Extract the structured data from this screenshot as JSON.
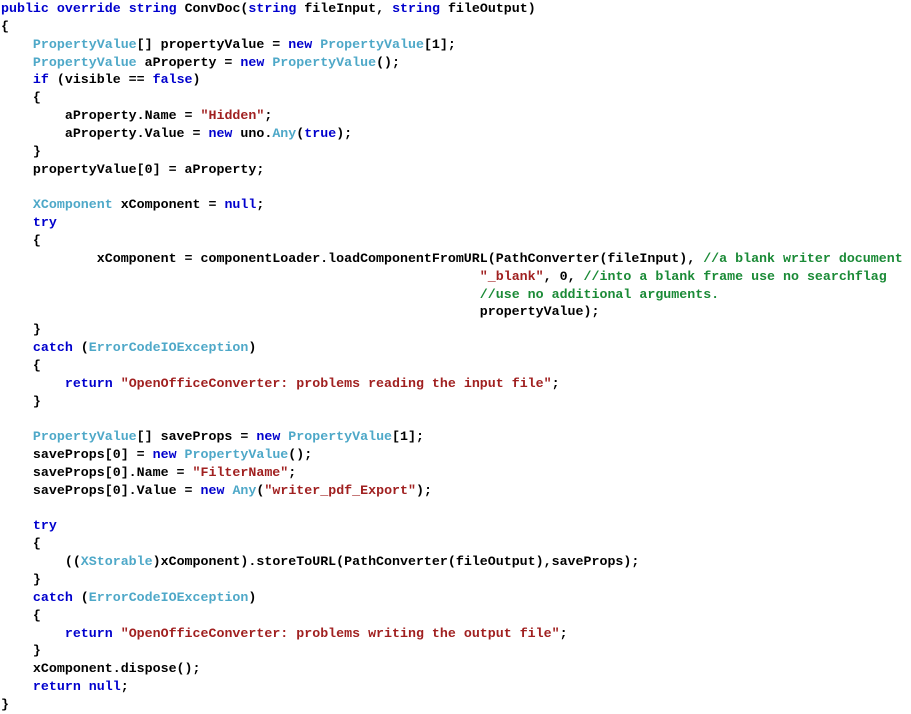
{
  "editor": {
    "language": "csharp",
    "background_color": "#ffffff",
    "font_size_px": 13.3,
    "line_height_px": 17.85,
    "colors": {
      "keyword": "#0000CD",
      "type": "#4EA8C8",
      "string": "#A02020",
      "comment": "#1A8A36",
      "plain": "#000000"
    }
  },
  "code": {
    "lines": [
      {
        "id": "line-1",
        "tokens": [
          {
            "t": "public",
            "c": "kw"
          },
          {
            "t": " ",
            "c": "pln"
          },
          {
            "t": "override",
            "c": "kw"
          },
          {
            "t": " ",
            "c": "pln"
          },
          {
            "t": "string",
            "c": "kw"
          },
          {
            "t": " ConvDoc(",
            "c": "pln"
          },
          {
            "t": "string",
            "c": "kw"
          },
          {
            "t": " fileInput, ",
            "c": "pln"
          },
          {
            "t": "string",
            "c": "kw"
          },
          {
            "t": " fileOutput)",
            "c": "pln"
          }
        ]
      },
      {
        "id": "line-2",
        "tokens": [
          {
            "t": "{",
            "c": "pln"
          }
        ]
      },
      {
        "id": "line-3",
        "tokens": [
          {
            "t": "    ",
            "c": "pln"
          },
          {
            "t": "PropertyValue",
            "c": "type"
          },
          {
            "t": "[] propertyValue = ",
            "c": "pln"
          },
          {
            "t": "new",
            "c": "kw"
          },
          {
            "t": " ",
            "c": "pln"
          },
          {
            "t": "PropertyValue",
            "c": "type"
          },
          {
            "t": "[1];",
            "c": "pln"
          }
        ]
      },
      {
        "id": "line-4",
        "tokens": [
          {
            "t": "    ",
            "c": "pln"
          },
          {
            "t": "PropertyValue",
            "c": "type"
          },
          {
            "t": " aProperty = ",
            "c": "pln"
          },
          {
            "t": "new",
            "c": "kw"
          },
          {
            "t": " ",
            "c": "pln"
          },
          {
            "t": "PropertyValue",
            "c": "type"
          },
          {
            "t": "();",
            "c": "pln"
          }
        ]
      },
      {
        "id": "line-5",
        "tokens": [
          {
            "t": "    ",
            "c": "pln"
          },
          {
            "t": "if",
            "c": "kw"
          },
          {
            "t": " (visible == ",
            "c": "pln"
          },
          {
            "t": "false",
            "c": "kw"
          },
          {
            "t": ")",
            "c": "pln"
          }
        ]
      },
      {
        "id": "line-6",
        "tokens": [
          {
            "t": "    {",
            "c": "pln"
          }
        ]
      },
      {
        "id": "line-7",
        "tokens": [
          {
            "t": "        aProperty.Name = ",
            "c": "pln"
          },
          {
            "t": "\"Hidden\"",
            "c": "str"
          },
          {
            "t": ";",
            "c": "pln"
          }
        ]
      },
      {
        "id": "line-8",
        "tokens": [
          {
            "t": "        aProperty.Value = ",
            "c": "pln"
          },
          {
            "t": "new",
            "c": "kw"
          },
          {
            "t": " uno.",
            "c": "pln"
          },
          {
            "t": "Any",
            "c": "type"
          },
          {
            "t": "(",
            "c": "pln"
          },
          {
            "t": "true",
            "c": "kw"
          },
          {
            "t": ");",
            "c": "pln"
          }
        ]
      },
      {
        "id": "line-9",
        "tokens": [
          {
            "t": "    }",
            "c": "pln"
          }
        ]
      },
      {
        "id": "line-10",
        "tokens": [
          {
            "t": "    propertyValue[0] = aProperty;",
            "c": "pln"
          }
        ]
      },
      {
        "id": "line-11",
        "tokens": [
          {
            "t": "",
            "c": "pln"
          }
        ]
      },
      {
        "id": "line-12",
        "tokens": [
          {
            "t": "    ",
            "c": "pln"
          },
          {
            "t": "XComponent",
            "c": "type"
          },
          {
            "t": " xComponent = ",
            "c": "pln"
          },
          {
            "t": "null",
            "c": "kw"
          },
          {
            "t": ";",
            "c": "pln"
          }
        ]
      },
      {
        "id": "line-13",
        "tokens": [
          {
            "t": "    ",
            "c": "pln"
          },
          {
            "t": "try",
            "c": "kw"
          }
        ]
      },
      {
        "id": "line-14",
        "tokens": [
          {
            "t": "    {",
            "c": "pln"
          }
        ]
      },
      {
        "id": "line-15",
        "tokens": [
          {
            "t": "            xComponent = componentLoader.loadComponentFromURL(PathConverter(fileInput), ",
            "c": "pln"
          },
          {
            "t": "//a blank writer document",
            "c": "com"
          }
        ]
      },
      {
        "id": "line-16",
        "tokens": [
          {
            "t": "                                                            ",
            "c": "pln"
          },
          {
            "t": "\"_blank\"",
            "c": "str"
          },
          {
            "t": ", 0, ",
            "c": "pln"
          },
          {
            "t": "//into a blank frame use no searchflag",
            "c": "com"
          }
        ]
      },
      {
        "id": "line-17",
        "tokens": [
          {
            "t": "                                                            ",
            "c": "pln"
          },
          {
            "t": "//use no additional arguments.",
            "c": "com"
          }
        ]
      },
      {
        "id": "line-18",
        "tokens": [
          {
            "t": "                                                            propertyValue);",
            "c": "pln"
          }
        ]
      },
      {
        "id": "line-19",
        "tokens": [
          {
            "t": "    }",
            "c": "pln"
          }
        ]
      },
      {
        "id": "line-20",
        "tokens": [
          {
            "t": "    ",
            "c": "pln"
          },
          {
            "t": "catch",
            "c": "kw"
          },
          {
            "t": " (",
            "c": "pln"
          },
          {
            "t": "ErrorCodeIOException",
            "c": "type"
          },
          {
            "t": ")",
            "c": "pln"
          }
        ]
      },
      {
        "id": "line-21",
        "tokens": [
          {
            "t": "    {",
            "c": "pln"
          }
        ]
      },
      {
        "id": "line-22",
        "tokens": [
          {
            "t": "        ",
            "c": "pln"
          },
          {
            "t": "return",
            "c": "kw"
          },
          {
            "t": " ",
            "c": "pln"
          },
          {
            "t": "\"OpenOfficeConverter: problems reading the input file\"",
            "c": "str"
          },
          {
            "t": ";",
            "c": "pln"
          }
        ]
      },
      {
        "id": "line-23",
        "tokens": [
          {
            "t": "    }",
            "c": "pln"
          }
        ]
      },
      {
        "id": "line-24",
        "tokens": [
          {
            "t": "",
            "c": "pln"
          }
        ]
      },
      {
        "id": "line-25",
        "tokens": [
          {
            "t": "    ",
            "c": "pln"
          },
          {
            "t": "PropertyValue",
            "c": "type"
          },
          {
            "t": "[] saveProps = ",
            "c": "pln"
          },
          {
            "t": "new",
            "c": "kw"
          },
          {
            "t": " ",
            "c": "pln"
          },
          {
            "t": "PropertyValue",
            "c": "type"
          },
          {
            "t": "[1];",
            "c": "pln"
          }
        ]
      },
      {
        "id": "line-26",
        "tokens": [
          {
            "t": "    saveProps[0] = ",
            "c": "pln"
          },
          {
            "t": "new",
            "c": "kw"
          },
          {
            "t": " ",
            "c": "pln"
          },
          {
            "t": "PropertyValue",
            "c": "type"
          },
          {
            "t": "();",
            "c": "pln"
          }
        ]
      },
      {
        "id": "line-27",
        "tokens": [
          {
            "t": "    saveProps[0].Name = ",
            "c": "pln"
          },
          {
            "t": "\"FilterName\"",
            "c": "str"
          },
          {
            "t": ";",
            "c": "pln"
          }
        ]
      },
      {
        "id": "line-28",
        "tokens": [
          {
            "t": "    saveProps[0].Value = ",
            "c": "pln"
          },
          {
            "t": "new",
            "c": "kw"
          },
          {
            "t": " ",
            "c": "pln"
          },
          {
            "t": "Any",
            "c": "type"
          },
          {
            "t": "(",
            "c": "pln"
          },
          {
            "t": "\"writer_pdf_Export\"",
            "c": "str"
          },
          {
            "t": ");",
            "c": "pln"
          }
        ]
      },
      {
        "id": "line-29",
        "tokens": [
          {
            "t": "",
            "c": "pln"
          }
        ]
      },
      {
        "id": "line-30",
        "tokens": [
          {
            "t": "    ",
            "c": "pln"
          },
          {
            "t": "try",
            "c": "kw"
          }
        ]
      },
      {
        "id": "line-31",
        "tokens": [
          {
            "t": "    {",
            "c": "pln"
          }
        ]
      },
      {
        "id": "line-32",
        "tokens": [
          {
            "t": "        ((",
            "c": "pln"
          },
          {
            "t": "XStorable",
            "c": "type"
          },
          {
            "t": ")xComponent).storeToURL(PathConverter(fileOutput),saveProps);",
            "c": "pln"
          }
        ]
      },
      {
        "id": "line-33",
        "tokens": [
          {
            "t": "    }",
            "c": "pln"
          }
        ]
      },
      {
        "id": "line-34",
        "tokens": [
          {
            "t": "    ",
            "c": "pln"
          },
          {
            "t": "catch",
            "c": "kw"
          },
          {
            "t": " (",
            "c": "pln"
          },
          {
            "t": "ErrorCodeIOException",
            "c": "type"
          },
          {
            "t": ")",
            "c": "pln"
          }
        ]
      },
      {
        "id": "line-35",
        "tokens": [
          {
            "t": "    {",
            "c": "pln"
          }
        ]
      },
      {
        "id": "line-36",
        "tokens": [
          {
            "t": "        ",
            "c": "pln"
          },
          {
            "t": "return",
            "c": "kw"
          },
          {
            "t": " ",
            "c": "pln"
          },
          {
            "t": "\"OpenOfficeConverter: problems writing the output file\"",
            "c": "str"
          },
          {
            "t": ";",
            "c": "pln"
          }
        ]
      },
      {
        "id": "line-37",
        "tokens": [
          {
            "t": "    }",
            "c": "pln"
          }
        ]
      },
      {
        "id": "line-38",
        "tokens": [
          {
            "t": "    xComponent.dispose();",
            "c": "pln"
          }
        ]
      },
      {
        "id": "line-39",
        "tokens": [
          {
            "t": "    ",
            "c": "pln"
          },
          {
            "t": "return",
            "c": "kw"
          },
          {
            "t": " ",
            "c": "pln"
          },
          {
            "t": "null",
            "c": "kw"
          },
          {
            "t": ";",
            "c": "pln"
          }
        ]
      },
      {
        "id": "line-40",
        "tokens": [
          {
            "t": "}",
            "c": "pln"
          }
        ]
      }
    ]
  }
}
